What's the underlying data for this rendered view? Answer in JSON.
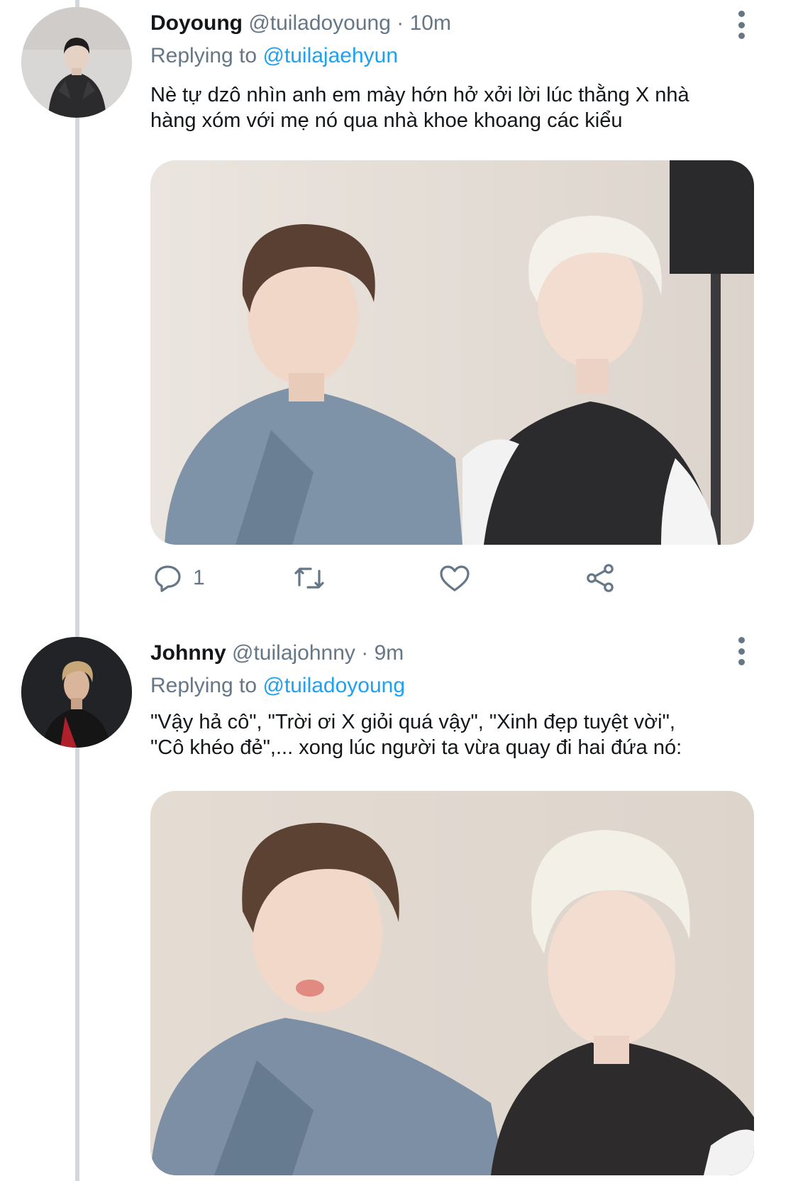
{
  "tweets": [
    {
      "name": "Doyoung",
      "handle": "@tuiladoyoung",
      "separator": "·",
      "time": "10m",
      "replying_prefix": "Replying to",
      "replying_handle": "@tuilajaehyun",
      "text_lines": [
        "Nè tự dzô nhìn anh em mày hớn hở xởi lời lúc thằng X nhà",
        "hàng xóm với mẹ nó qua nhà khoe khoang các kiểu"
      ],
      "reply_count": "1",
      "icons": {
        "more": "more-vertical-icon",
        "reply": "reply-icon",
        "retweet": "retweet-icon",
        "like": "heart-icon",
        "share": "share-icon"
      }
    },
    {
      "name": "Johnny",
      "handle": "@tuilajohnny",
      "separator": "·",
      "time": "9m",
      "replying_prefix": "Replying to",
      "replying_handle": "@tuiladoyoung",
      "text_lines": [
        "\"Vậy hả cô\", \"Trời ơi X giỏi quá vậy\", \"Xinh đẹp tuyệt vời\",",
        "\"Cô khéo đẻ\",... xong lúc người ta vừa quay đi hai đứa nó:"
      ],
      "icons": {
        "more": "more-vertical-icon"
      }
    }
  ],
  "colors": {
    "text": "#14171a",
    "secondary": "#657786",
    "link": "#1da1f2",
    "thread_line": "#d3d8dc"
  }
}
